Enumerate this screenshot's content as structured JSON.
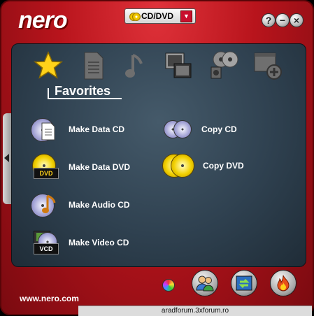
{
  "app": {
    "brand": "nero",
    "url": "www.nero.com"
  },
  "selector": {
    "value": "CD/DVD",
    "arrow": "▼"
  },
  "window_buttons": {
    "help": "?",
    "minimize": "−",
    "close": "×"
  },
  "categories": {
    "active_label": "Favorites"
  },
  "tasks": [
    {
      "label": "Make Data CD"
    },
    {
      "label": "Copy CD"
    },
    {
      "label": "Make Data DVD"
    },
    {
      "label": "Copy DVD"
    },
    {
      "label": "Make Audio CD"
    },
    {
      "label": "Make Video CD"
    }
  ],
  "icon_text": {
    "dvd": "DVD",
    "vcd": "VCD"
  },
  "status_bar": {
    "text": "aradforum.3xforum.ro"
  },
  "colors": {
    "frame_red": "#b8141c",
    "panel": "#2f4150"
  }
}
